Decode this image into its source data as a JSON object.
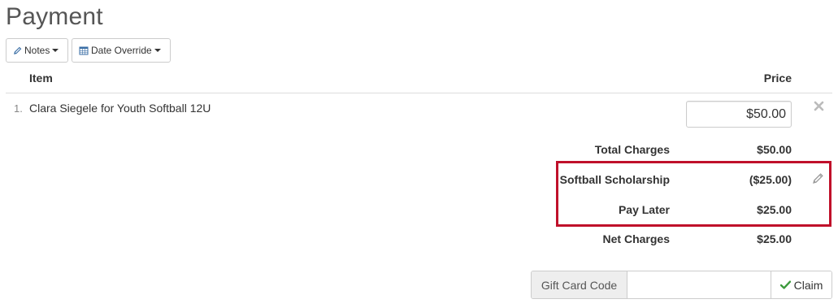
{
  "page": {
    "title": "Payment"
  },
  "toolbar": {
    "notes_label": "Notes",
    "notes_icon": "pencil-icon",
    "date_override_label": "Date Override",
    "date_override_icon": "calendar-icon"
  },
  "table": {
    "headers": {
      "item": "Item",
      "price": "Price"
    },
    "rows": [
      {
        "number": "1.",
        "item": "Clara Siegele for Youth Softball 12U",
        "price": "$50.00"
      }
    ]
  },
  "summary": {
    "total_charges": {
      "label": "Total Charges",
      "value": "$50.00"
    },
    "scholarship": {
      "label": "Softball Scholarship",
      "value": "($25.00)"
    },
    "pay_later": {
      "label": "Pay Later",
      "value": "$25.00"
    },
    "net_charges": {
      "label": "Net Charges",
      "value": "$25.00"
    }
  },
  "gift_card": {
    "addon_label": "Gift Card Code",
    "input_value": "",
    "placeholder": "",
    "claim_label": "Claim"
  },
  "colors": {
    "highlight_border": "#c0102a",
    "claim_check": "#3c9a3c",
    "icon_blue": "#3a6ea5"
  }
}
